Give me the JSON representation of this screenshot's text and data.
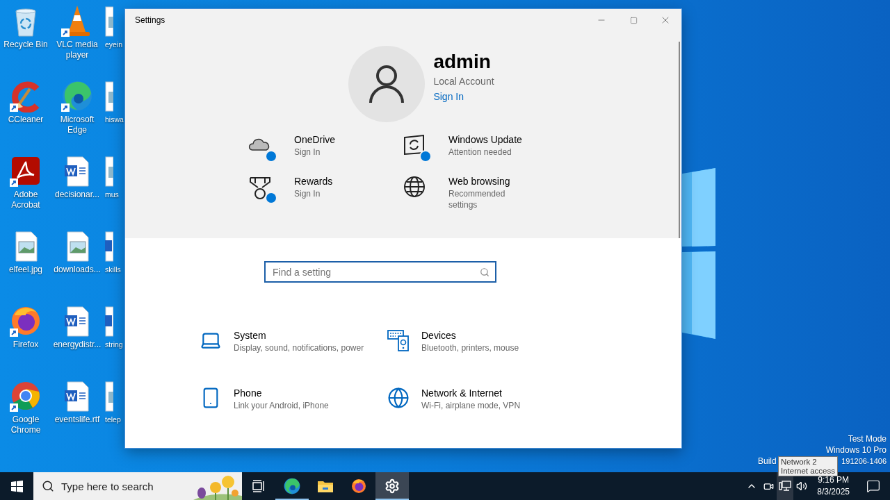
{
  "desktop_columns": [
    [
      {
        "label": "Recycle Bin",
        "kind": "recycle",
        "shortcut": false
      },
      {
        "label": "CCleaner",
        "kind": "ccleaner",
        "shortcut": true
      },
      {
        "label": "Adobe Acrobat",
        "kind": "acrobat",
        "shortcut": true
      },
      {
        "label": "elfeel.jpg",
        "kind": "image",
        "shortcut": false
      },
      {
        "label": "Firefox",
        "kind": "firefox",
        "shortcut": true
      },
      {
        "label": "Google Chrome",
        "kind": "chrome",
        "shortcut": true
      }
    ],
    [
      {
        "label": "VLC media player",
        "kind": "vlc",
        "shortcut": true
      },
      {
        "label": "Microsoft Edge",
        "kind": "edge",
        "shortcut": true
      },
      {
        "label": "decisionar...",
        "kind": "word",
        "shortcut": false
      },
      {
        "label": "downloads...",
        "kind": "image",
        "shortcut": false
      },
      {
        "label": "energydistr...",
        "kind": "word",
        "shortcut": false
      },
      {
        "label": "eventslife.rtf",
        "kind": "word",
        "shortcut": false
      }
    ],
    [
      {
        "label": "eyein",
        "kind": "image"
      },
      {
        "label": "hiswa",
        "kind": "image"
      },
      {
        "label": "mus",
        "kind": "image"
      },
      {
        "label": "skills",
        "kind": "word"
      },
      {
        "label": "string",
        "kind": "word"
      },
      {
        "label": "telep",
        "kind": "image"
      }
    ]
  ],
  "system_info": {
    "lines": [
      "Test Mode",
      "Windows 10 Pro"
    ],
    "build_start": "Build",
    "build_end": "191206-1406"
  },
  "tooltip": [
    "Network 2",
    "Internet access"
  ],
  "settings_window": {
    "title": "Settings",
    "account": {
      "name": "admin",
      "type": "Local Account",
      "sign_in": "Sign In"
    },
    "status_items": [
      {
        "kind": "onedrive",
        "title": "OneDrive",
        "subtitle": "Sign In",
        "badge": true
      },
      {
        "kind": "update",
        "title": "Windows Update",
        "subtitle": "Attention needed",
        "badge": true
      },
      {
        "kind": "rewards",
        "title": "Rewards",
        "subtitle": "Sign In",
        "badge": true
      },
      {
        "kind": "browsing",
        "title": "Web browsing",
        "subtitle": "Recommended settings",
        "badge": false
      }
    ],
    "search": {
      "placeholder": "Find a setting"
    },
    "categories": [
      {
        "kind": "system",
        "title": "System",
        "subtitle": "Display, sound, notifications, power"
      },
      {
        "kind": "devices",
        "title": "Devices",
        "subtitle": "Bluetooth, printers, mouse"
      },
      {
        "kind": "phone",
        "title": "Phone",
        "subtitle": "Link your Android, iPhone"
      },
      {
        "kind": "network",
        "title": "Network & Internet",
        "subtitle": "Wi-Fi, airplane mode, VPN"
      }
    ]
  },
  "taskbar": {
    "search_placeholder": "Type here to search",
    "apps": [
      {
        "kind": "taskview",
        "running": false,
        "selected": false
      },
      {
        "kind": "edge",
        "running": true,
        "selected": false
      },
      {
        "kind": "explorer",
        "running": false,
        "selected": false
      },
      {
        "kind": "firefox",
        "running": false,
        "selected": false
      },
      {
        "kind": "settings",
        "running": true,
        "selected": true
      }
    ],
    "time": "9:16 PM",
    "date": "8/3/2025"
  }
}
